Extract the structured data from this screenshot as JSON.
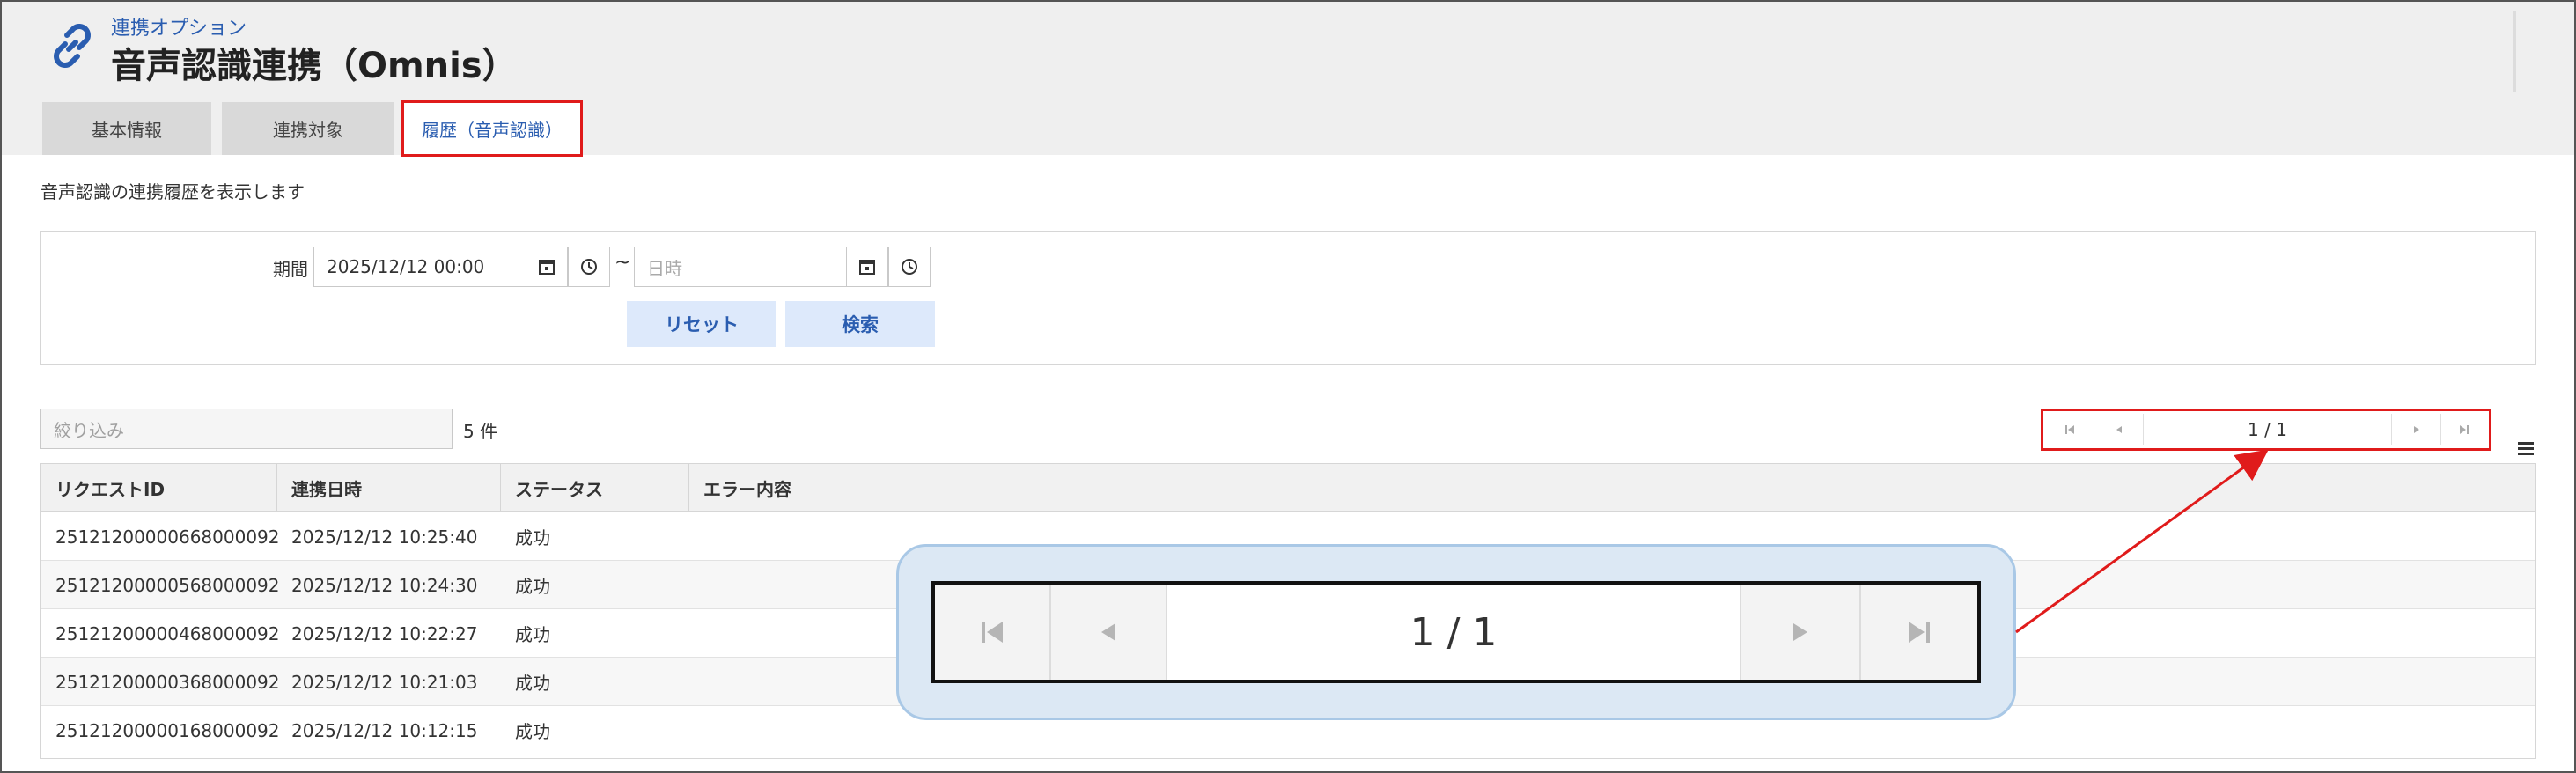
{
  "header": {
    "subtitle": "連携オプション",
    "title": "音声認識連携（Omnis）",
    "icon": "link-icon"
  },
  "tabs": [
    {
      "label": "基本情報",
      "active": false
    },
    {
      "label": "連携対象",
      "active": false
    },
    {
      "label": "履歴（音声認識）",
      "active": true
    }
  ],
  "description": "音声認識の連携履歴を表示します",
  "search": {
    "period_label": "期間",
    "from_value": "2025/12/12 00:00",
    "to_placeholder": "日時",
    "separator": "~",
    "reset_label": "リセット",
    "search_label": "検索"
  },
  "list": {
    "filter_placeholder": "絞り込み",
    "count": "5 件",
    "pager_text": "1 / 1",
    "columns": [
      "リクエストID",
      "連携日時",
      "ステータス",
      "エラー内容"
    ],
    "rows": [
      {
        "id": "25121200000668000092",
        "datetime": "2025/12/12 10:25:40",
        "status": "成功",
        "error": ""
      },
      {
        "id": "25121200000568000092",
        "datetime": "2025/12/12 10:24:30",
        "status": "成功",
        "error": ""
      },
      {
        "id": "25121200000468000092",
        "datetime": "2025/12/12 10:22:27",
        "status": "成功",
        "error": ""
      },
      {
        "id": "25121200000368000092",
        "datetime": "2025/12/12 10:21:03",
        "status": "成功",
        "error": ""
      },
      {
        "id": "25121200000168000092",
        "datetime": "2025/12/12 10:12:15",
        "status": "成功",
        "error": ""
      }
    ]
  },
  "zoom": {
    "pager_text": "1 / 1"
  },
  "colors": {
    "accent": "#2a5db0",
    "highlight": "#e01b1b",
    "callout_bg": "#dce8f4"
  }
}
